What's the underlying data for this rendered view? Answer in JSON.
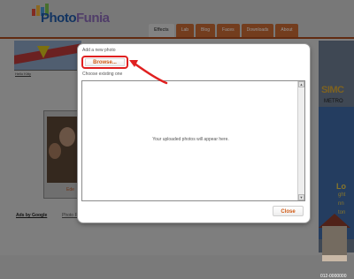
{
  "header": {
    "logo_text_main": "Photo",
    "logo_text_accent": "Funia",
    "nav_tabs": [
      "Effects",
      "Lab",
      "Blog",
      "Faces",
      "Downloads",
      "About"
    ]
  },
  "left": {
    "thumb_link": "Hello Kitty",
    "photo_caption": "Ede",
    "ads_link": "Ads by Google",
    "photofunia_link": "Photo Fun"
  },
  "right_ad": {
    "brand": "SIMC",
    "sub": "METRO",
    "headline": "Lo",
    "line1": "ght",
    "line2": "nn",
    "line3": "ton",
    "phone": "012-0000000"
  },
  "dialog": {
    "add_label": "Add a new photo",
    "browse_label": "Browse...",
    "existing_label": "Choose existing one",
    "empty_message": "Your uploaded photos will appear here.",
    "close_label": "Close"
  },
  "colors": {
    "accent_orange": "#d05a14",
    "highlight_red": "#e02020"
  }
}
